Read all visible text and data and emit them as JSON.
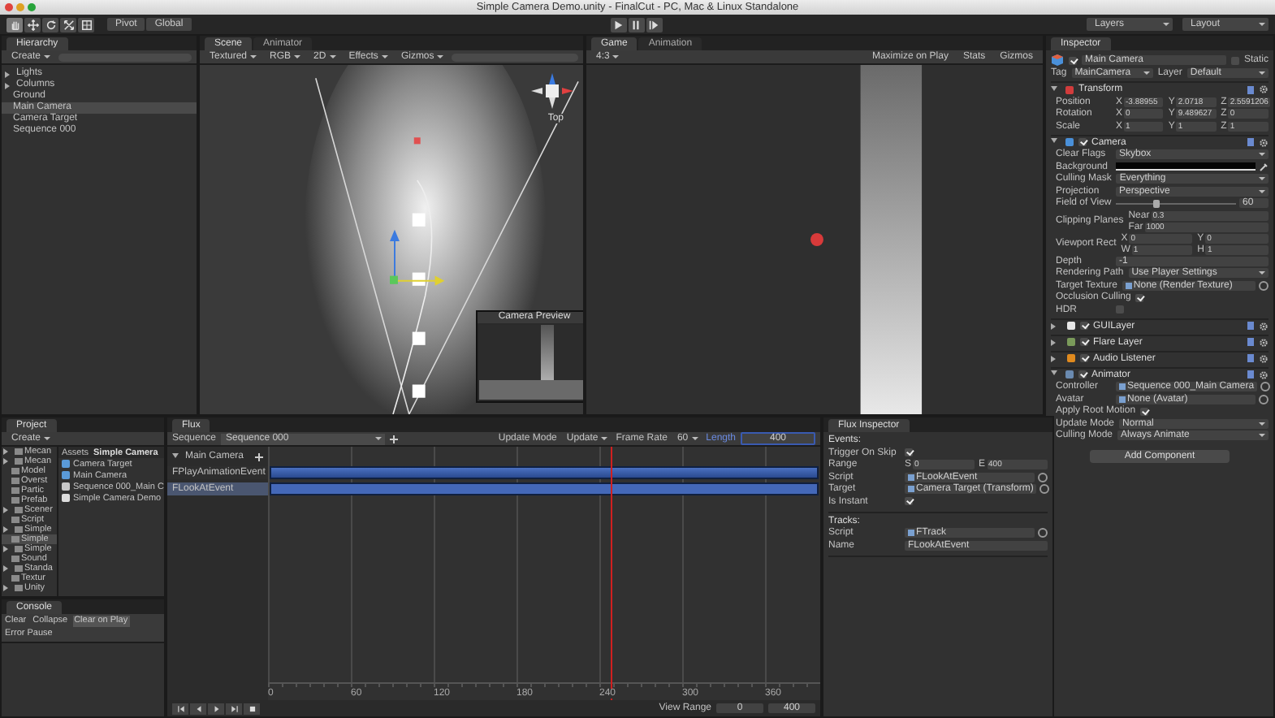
{
  "title_bar": {
    "title": "Simple Camera Demo.unity - FinalCut - PC, Mac & Linux Standalone"
  },
  "toolbar": {
    "tools": [
      {
        "kind": "hand",
        "selected": true
      },
      {
        "kind": "move",
        "selected": false
      },
      {
        "kind": "rotate",
        "selected": false
      },
      {
        "kind": "scale",
        "selected": false
      },
      {
        "kind": "rect",
        "selected": false
      }
    ],
    "pivot": "Pivot",
    "global": "Global",
    "playback": [
      {
        "kind": "play",
        "selected": false
      },
      {
        "kind": "pause",
        "selected": false
      },
      {
        "kind": "step",
        "selected": false
      }
    ],
    "layers": "Layers",
    "layout": "Layout"
  },
  "hierarchy": {
    "tab": "Hierarchy",
    "create": "Create",
    "items": [
      {
        "label": "Lights",
        "expandable": true,
        "selected": false
      },
      {
        "label": "Columns",
        "expandable": true,
        "selected": false
      },
      {
        "label": "Ground",
        "expandable": false,
        "selected": false
      },
      {
        "label": "Main Camera",
        "expandable": false,
        "selected": true
      },
      {
        "label": "Camera Target",
        "expandable": false,
        "selected": false
      },
      {
        "label": "Sequence 000",
        "expandable": false,
        "selected": false
      }
    ]
  },
  "scene": {
    "tabs": [
      {
        "label": "Scene",
        "selected": true
      },
      {
        "label": "Animator",
        "selected": false
      }
    ],
    "toolbar": [
      "Textured",
      "RGB",
      "2D",
      "Effects",
      "Gizmos"
    ],
    "gizmo_label": "Top",
    "preview_title": "Camera Preview"
  },
  "game": {
    "tabs": [
      {
        "label": "Game",
        "selected": true
      },
      {
        "label": "Animation",
        "selected": false
      }
    ],
    "aspect": "4:3",
    "toolbar": [
      "Maximize on Play",
      "Stats",
      "Gizmos"
    ]
  },
  "inspector": {
    "tab": "Inspector",
    "object": {
      "name": "Main Camera",
      "active": true,
      "static_label": "Static",
      "static": false,
      "tag_label": "Tag",
      "tag": "MainCamera",
      "layer_label": "Layer",
      "layer": "Default"
    },
    "components": [
      {
        "name": "Transform",
        "kind": "transform",
        "expanded": true,
        "rows": [
          {
            "label": "Position",
            "kind": "xyz",
            "fields": [
              {
                "axis": "X",
                "value": "-3.88955"
              },
              {
                "axis": "Y",
                "value": "2.0718"
              },
              {
                "axis": "Z",
                "value": "2.5591206"
              }
            ]
          },
          {
            "label": "Rotation",
            "kind": "xyz",
            "fields": [
              {
                "axis": "X",
                "value": "0"
              },
              {
                "axis": "Y",
                "value": "9.489627"
              },
              {
                "axis": "Z",
                "value": "0"
              }
            ]
          },
          {
            "label": "Scale",
            "kind": "xyz",
            "fields": [
              {
                "axis": "X",
                "value": "1"
              },
              {
                "axis": "Y",
                "value": "1"
              },
              {
                "axis": "Z",
                "value": "1"
              }
            ]
          }
        ]
      },
      {
        "name": "Camera",
        "kind": "camera",
        "expanded": true,
        "enabled": true,
        "rows": [
          {
            "label": "Clear Flags",
            "kind": "dropdown",
            "value": "Skybox"
          },
          {
            "label": "Background",
            "kind": "color"
          },
          {
            "label": "Culling Mask",
            "kind": "dropdown",
            "value": "Everything"
          },
          {
            "label": "Projection",
            "kind": "dropdown",
            "value": "Perspective"
          },
          {
            "label": "Field of View",
            "kind": "slider",
            "level": 0.33,
            "value": "60"
          },
          {
            "label": "Clipping Planes",
            "kind": "stack",
            "fields": [
              {
                "axis": "Near",
                "value": "0.3"
              },
              {
                "axis": "Far",
                "value": "1000"
              }
            ]
          },
          {
            "label": "Viewport Rect",
            "kind": "pairs",
            "fields": [
              {
                "axis": "X",
                "value": "0"
              },
              {
                "axis": "Y",
                "value": "0"
              },
              {
                "axis": "W",
                "value": "1"
              },
              {
                "axis": "H",
                "value": "1"
              }
            ]
          },
          {
            "label": "Depth",
            "kind": "text",
            "value": "-1"
          },
          {
            "label": "Rendering Path",
            "kind": "dropdown",
            "value": "Use Player Settings"
          },
          {
            "label": "Target Texture",
            "kind": "object",
            "value": "None (Render Texture)"
          },
          {
            "label": "Occlusion Culling",
            "kind": "check",
            "checked": true
          },
          {
            "label": "HDR",
            "kind": "check",
            "checked": false
          }
        ]
      },
      {
        "name": "GUILayer",
        "kind": "guilayer",
        "expanded": false,
        "enabled": true
      },
      {
        "name": "Flare Layer",
        "kind": "flare",
        "expanded": false,
        "enabled": true
      },
      {
        "name": "Audio Listener",
        "kind": "audio",
        "expanded": false,
        "enabled": true
      },
      {
        "name": "Animator",
        "kind": "animator",
        "expanded": true,
        "enabled": true,
        "rows": [
          {
            "label": "Controller",
            "kind": "object",
            "value": "Sequence 000_Main Camera"
          },
          {
            "label": "Avatar",
            "kind": "object",
            "value": "None (Avatar)"
          },
          {
            "label": "Apply Root Motion",
            "kind": "check",
            "checked": true
          },
          {
            "label": "Update Mode",
            "kind": "dropdown",
            "value": "Normal"
          },
          {
            "label": "Culling Mode",
            "kind": "dropdown",
            "value": "Always Animate"
          }
        ]
      }
    ],
    "add_button": "Add Component"
  },
  "project": {
    "tab": "Project",
    "create": "Create",
    "folders": [
      {
        "label": "Mecan",
        "expandable": true,
        "selected": false
      },
      {
        "label": "Mecan",
        "expandable": true,
        "selected": false
      },
      {
        "label": "Model",
        "expandable": false,
        "selected": false
      },
      {
        "label": "Overst",
        "expandable": false,
        "selected": false
      },
      {
        "label": "Partic",
        "expandable": false,
        "selected": false
      },
      {
        "label": "Prefab",
        "expandable": false,
        "selected": false
      },
      {
        "label": "Scener",
        "expandable": true,
        "selected": false
      },
      {
        "label": "Script",
        "expandable": false,
        "selected": false
      },
      {
        "label": "Simple",
        "expandable": true,
        "selected": false
      },
      {
        "label": "Simple",
        "expandable": false,
        "selected": true
      },
      {
        "label": "Simple",
        "expandable": true,
        "selected": false
      },
      {
        "label": "Sound",
        "expandable": false,
        "selected": false
      },
      {
        "label": "Standa",
        "expandable": true,
        "selected": false
      },
      {
        "label": "Textur",
        "expandable": false,
        "selected": false
      },
      {
        "label": "Unity",
        "expandable": true,
        "selected": false
      }
    ],
    "breadcrumb": [
      "Assets",
      "Simple Camera"
    ],
    "assets": [
      {
        "label": "Camera Target",
        "kind": "prefab"
      },
      {
        "label": "Main Camera",
        "kind": "prefab"
      },
      {
        "label": "Sequence 000_Main C",
        "kind": "controller"
      },
      {
        "label": "Simple Camera Demo",
        "kind": "scene"
      }
    ]
  },
  "console": {
    "tab": "Console",
    "buttons": [
      {
        "label": "Clear",
        "selected": false
      },
      {
        "label": "Collapse",
        "selected": false
      },
      {
        "label": "Clear on Play",
        "selected": true
      },
      {
        "label": "Error Pause",
        "selected": false
      }
    ]
  },
  "flux": {
    "tab": "Flux",
    "sequence_label": "Sequence",
    "sequence": "Sequence 000",
    "update_mode_label": "Update Mode",
    "update_mode": "Update",
    "frame_rate_label": "Frame Rate",
    "frame_rate": "60",
    "length_label": "Length",
    "length": "400",
    "container": "Main Camera",
    "tracks": [
      {
        "label": "FPlayAnimationEvent",
        "selected": false
      },
      {
        "label": "FLookAtEvent",
        "selected": true
      }
    ],
    "ruler": [
      "0",
      "60",
      "120",
      "180",
      "240",
      "300",
      "360"
    ],
    "playhead": {
      "level": 0.62
    },
    "view_range_label": "View Range",
    "view_start": "0",
    "view_end": "400"
  },
  "flux_inspector": {
    "tab": "Flux Inspector",
    "sections": [
      {
        "title": "Events:",
        "rows": [
          {
            "label": "Trigger On Skip",
            "kind": "check",
            "checked": true
          },
          {
            "label": "Range",
            "kind": "pairs",
            "fields": [
              {
                "axis": "S",
                "value": "0"
              },
              {
                "axis": "E",
                "value": "400"
              }
            ]
          },
          {
            "label": "Script",
            "kind": "object",
            "value": "FLookAtEvent"
          },
          {
            "label": "Target",
            "kind": "object",
            "value": "Camera Target (Transform)"
          },
          {
            "label": "Is Instant",
            "kind": "check",
            "checked": true
          }
        ]
      },
      {
        "title": "Tracks:",
        "rows": [
          {
            "label": "Script",
            "kind": "object",
            "value": "FTrack"
          },
          {
            "label": "Name",
            "kind": "text",
            "value": "FLookAtEvent"
          }
        ]
      }
    ]
  }
}
